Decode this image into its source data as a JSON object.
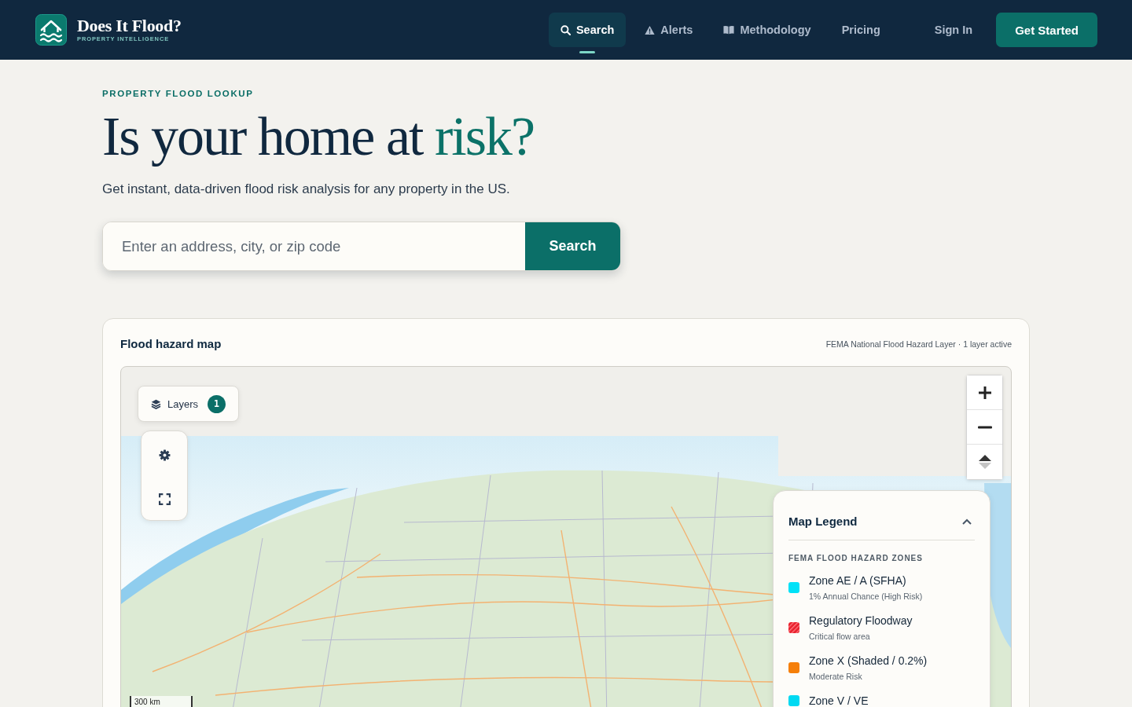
{
  "header": {
    "brand": "Does It Flood?",
    "tagline": "PROPERTY INTELLIGENCE",
    "nav": [
      {
        "label": "Search",
        "selected": true
      },
      {
        "label": "Alerts",
        "selected": false
      },
      {
        "label": "Methodology",
        "selected": false
      },
      {
        "label": "Pricing",
        "selected": false
      }
    ],
    "sign_in": "Sign In",
    "cta": "Get Started"
  },
  "hero": {
    "eyebrow": "PROPERTY FLOOD LOOKUP",
    "headline": "Is your home at",
    "headline_accent": "risk?",
    "subtitle": "Get instant, data-driven flood risk analysis for any property in the US.",
    "search": {
      "placeholder": "Enter an address, city, or zip code",
      "button": "Search"
    }
  },
  "map_card": {
    "title": "Flood hazard map",
    "source_note": "FEMA National Flood Hazard Layer · 1 layer active",
    "layers": {
      "label": "Layers",
      "count": "1"
    },
    "scale": "300 km",
    "legend": {
      "title": "Map Legend",
      "expanded": true,
      "section": "FEMA FLOOD HAZARD ZONES",
      "items": [
        {
          "label": "Zone AE / A (SFHA)",
          "description": "1% Annual Chance (High Risk)",
          "color": "#00e1f7",
          "kind": "solid"
        },
        {
          "label": "Regulatory Floodway",
          "description": "Critical flow area",
          "color": "#e81f2c",
          "kind": "hatched"
        },
        {
          "label": "Zone X (Shaded / 0.2%)",
          "description": "Moderate Risk",
          "color": "#f57f0a",
          "kind": "solid"
        },
        {
          "label": "Zone V / VE",
          "color": "#00d9f2",
          "kind": "solid"
        }
      ]
    }
  }
}
